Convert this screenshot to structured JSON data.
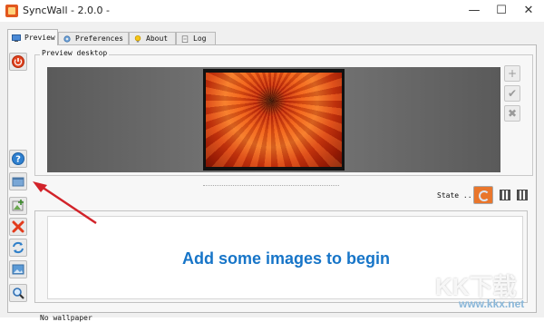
{
  "window": {
    "title": "SyncWall - 2.0.0 -",
    "minimize": "—",
    "maximize": "☐",
    "close": "✕"
  },
  "tabs": [
    {
      "label": "Preview",
      "icon": "monitor-icon",
      "active": true
    },
    {
      "label": "Preferences",
      "icon": "gear-icon",
      "active": false
    },
    {
      "label": "About",
      "icon": "lightbulb-icon",
      "active": false
    },
    {
      "label": "Log",
      "icon": "notepad-icon",
      "active": false
    }
  ],
  "preview": {
    "group_label": "Preview desktop",
    "right_buttons": [
      {
        "icon": "plus-icon",
        "symbol": "+"
      },
      {
        "icon": "check-icon",
        "symbol": "✔"
      },
      {
        "icon": "x-icon",
        "symbol": "✖"
      }
    ]
  },
  "state": {
    "label": "State ...",
    "icon": "sync-state-icon",
    "view_icons": [
      "view-columns-icon",
      "view-grid-icon"
    ]
  },
  "sidebar": {
    "buttons": [
      {
        "icon": "power-icon"
      },
      {
        "icon": "help-icon"
      },
      {
        "icon": "wallpaper-folder-icon"
      },
      {
        "icon": "add-image-icon"
      },
      {
        "icon": "delete-icon"
      },
      {
        "icon": "refresh-icon"
      },
      {
        "icon": "image-icon"
      },
      {
        "icon": "search-icon"
      }
    ]
  },
  "list": {
    "empty_message": "Add some images to begin"
  },
  "status": {
    "text": "No wallpaper"
  },
  "watermark": {
    "text": "KK下载",
    "url": "www.kkx.net"
  },
  "colors": {
    "accent_blue": "#1775c8",
    "power_red": "#e0431f",
    "arrow_red": "#d2232a"
  }
}
